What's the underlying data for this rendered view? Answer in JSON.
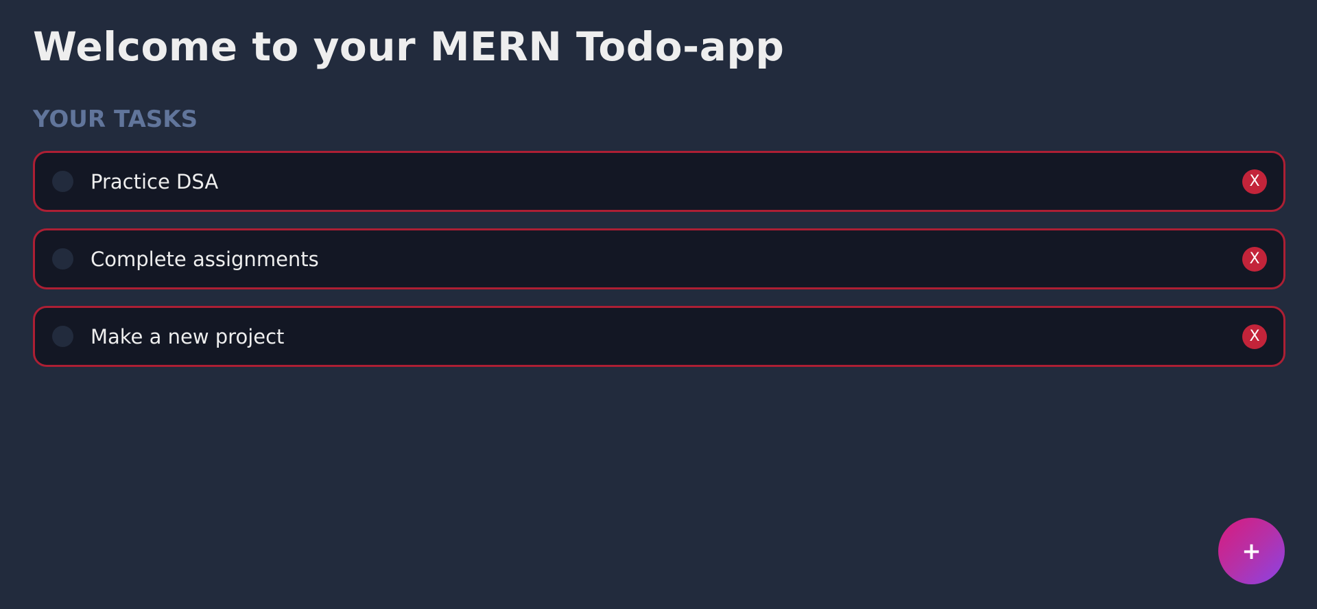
{
  "header": {
    "title": "Welcome to your MERN Todo-app"
  },
  "tasks_section": {
    "title": "YOUR TASKS",
    "items": [
      {
        "text": "Practice DSA",
        "completed": false,
        "delete_label": "X"
      },
      {
        "text": "Complete assignments",
        "completed": false,
        "delete_label": "X"
      },
      {
        "text": "Make a new project",
        "completed": false,
        "delete_label": "X"
      }
    ]
  },
  "add_button": {
    "label": "+"
  },
  "colors": {
    "background": "#222b3d",
    "item_background": "#131724",
    "item_border": "#ad1f34",
    "delete_button": "#c3243a",
    "section_title": "#61759b",
    "add_gradient_start": "#d81b7d",
    "add_gradient_end": "#8a44e6"
  }
}
